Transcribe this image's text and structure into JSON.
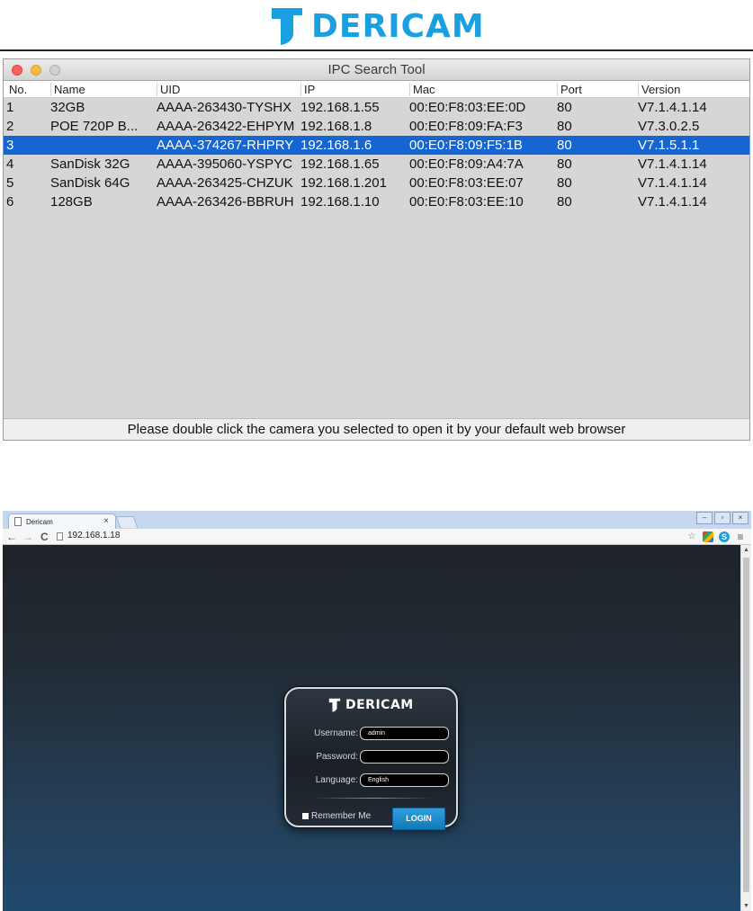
{
  "logo": {
    "text": "DERICAM",
    "color": "#1aa0e0"
  },
  "ipc": {
    "title": "IPC Search Tool",
    "columns": [
      "No.",
      "Name",
      "UID",
      "IP",
      "Mac",
      "Port",
      "Version"
    ],
    "rows": [
      {
        "no": "1",
        "name": "32GB",
        "uid": "AAAA-263430-TYSHX",
        "ip": "192.168.1.55",
        "mac": "00:E0:F8:03:EE:0D",
        "port": "80",
        "version": "V7.1.4.1.14"
      },
      {
        "no": "2",
        "name": "POE 720P B...",
        "uid": "AAAA-263422-EHPYM",
        "ip": "192.168.1.8",
        "mac": "00:E0:F8:09:FA:F3",
        "port": "80",
        "version": "V7.3.0.2.5"
      },
      {
        "no": "3",
        "name": "",
        "uid": "AAAA-374267-RHPRY",
        "ip": "192.168.1.6",
        "mac": "00:E0:F8:09:F5:1B",
        "port": "80",
        "version": "V7.1.5.1.1",
        "selected": true
      },
      {
        "no": "4",
        "name": "SanDisk 32G",
        "uid": "AAAA-395060-YSPYC",
        "ip": "192.168.1.65",
        "mac": "00:E0:F8:09:A4:7A",
        "port": "80",
        "version": "V7.1.4.1.14"
      },
      {
        "no": "5",
        "name": "SanDisk 64G",
        "uid": "AAAA-263425-CHZUK",
        "ip": "192.168.1.201",
        "mac": "00:E0:F8:03:EE:07",
        "port": "80",
        "version": "V7.1.4.1.14"
      },
      {
        "no": "6",
        "name": "128GB",
        "uid": "AAAA-263426-BBRUH",
        "ip": "192.168.1.10",
        "mac": "00:E0:F8:03:EE:10",
        "port": "80",
        "version": "V7.1.4.1.14"
      }
    ],
    "footer": "Please double click the camera you selected to open it by your default web browser",
    "selection_color": "#1566d2"
  },
  "browser": {
    "tab_title": "Dericam",
    "tab_close": "×",
    "url": "192.168.1.18",
    "icons": [
      "back-icon",
      "forward-icon",
      "reload-icon",
      "page-icon",
      "star-icon",
      "extension-icon",
      "skype-icon",
      "menu-icon"
    ],
    "login": {
      "brand": "DERICAM",
      "username_label": "Username:",
      "username_value": "admin",
      "password_label": "Password:",
      "password_value": "",
      "language_label": "Language:",
      "language_value": "English",
      "remember_label": "Remember Me",
      "login_button": "LOGIN",
      "button_color": "#1a8fd0"
    }
  }
}
